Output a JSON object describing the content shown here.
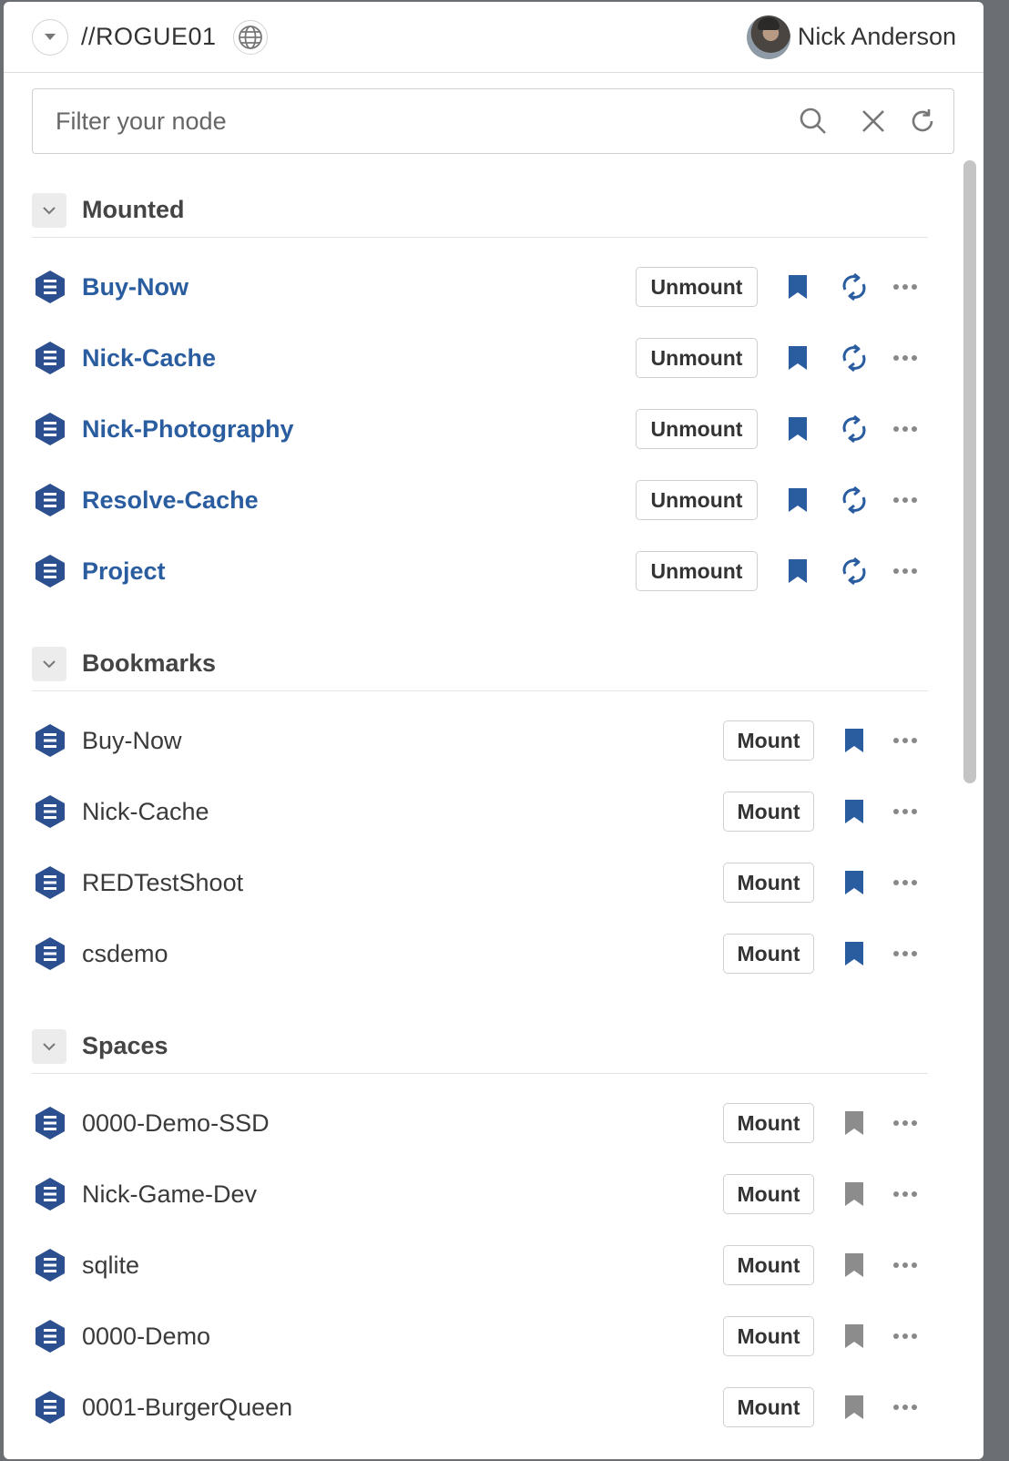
{
  "header": {
    "node_name": "//ROGUE01",
    "user_name": "Nick Anderson"
  },
  "search": {
    "placeholder": "Filter your node",
    "value": ""
  },
  "colors": {
    "accent": "#2a5d9f",
    "bookmark_on": "#2a5d9f",
    "bookmark_off": "#8c8c8c",
    "node_icon": "#2b4f8f"
  },
  "sections": {
    "mounted": {
      "title": "Mounted",
      "items": [
        {
          "label": "Buy-Now",
          "action": "Unmount"
        },
        {
          "label": "Nick-Cache",
          "action": "Unmount"
        },
        {
          "label": "Nick-Photography",
          "action": "Unmount"
        },
        {
          "label": "Resolve-Cache",
          "action": "Unmount"
        },
        {
          "label": "Project",
          "action": "Unmount"
        }
      ]
    },
    "bookmarks": {
      "title": "Bookmarks",
      "items": [
        {
          "label": "Buy-Now",
          "action": "Mount"
        },
        {
          "label": "Nick-Cache",
          "action": "Mount"
        },
        {
          "label": "REDTestShoot",
          "action": "Mount"
        },
        {
          "label": "csdemo",
          "action": "Mount"
        }
      ]
    },
    "spaces": {
      "title": "Spaces",
      "items": [
        {
          "label": "0000-Demo-SSD",
          "action": "Mount"
        },
        {
          "label": "Nick-Game-Dev",
          "action": "Mount"
        },
        {
          "label": "sqlite",
          "action": "Mount"
        },
        {
          "label": "0000-Demo",
          "action": "Mount"
        },
        {
          "label": "0001-BurgerQueen",
          "action": "Mount"
        }
      ]
    }
  }
}
